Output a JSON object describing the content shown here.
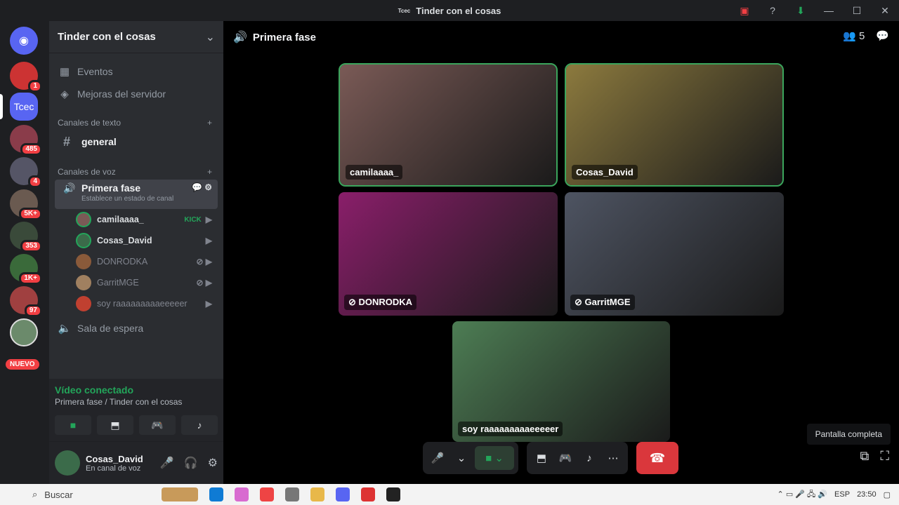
{
  "window": {
    "title": "Tinder con el cosas",
    "server_abbr": "Tcec"
  },
  "guilds": {
    "home_label": "Discord",
    "active_label": "Tcec",
    "badges": [
      "1",
      "485",
      "4",
      "5K+",
      "353",
      "1K+",
      "97"
    ],
    "new_label": "NUEVO"
  },
  "server": {
    "name": "Tinder con el cosas",
    "events": "Eventos",
    "boosts": "Mejoras del servidor",
    "text_category": "Canales de texto",
    "text_channel": "general",
    "voice_category": "Canales de voz",
    "voice_channel": "Primera fase",
    "voice_status_placeholder": "Establece un estado de canal",
    "voice_users": [
      {
        "name": "camilaaaa_",
        "tag": "KICK"
      },
      {
        "name": "Cosas_David"
      },
      {
        "name": "DONRODKA"
      },
      {
        "name": "GarritMGE"
      },
      {
        "name": "soy raaaaaaaaaeeeeer"
      }
    ],
    "waiting_room": "Sala de espera"
  },
  "voice_panel": {
    "status": "Vídeo conectado",
    "location": "Primera fase / Tinder con el cosas"
  },
  "user_panel": {
    "name": "Cosas_David",
    "status": "En canal de voz"
  },
  "main": {
    "channel": "Primera fase",
    "member_count": "5",
    "tiles": [
      {
        "label": "camilaaaa_",
        "color": "#7a5a56"
      },
      {
        "label": "Cosas_David",
        "color": "#8c7a3e"
      },
      {
        "label": "DONRODKA",
        "color": "#8a1e6a"
      },
      {
        "label": "GarritMGE",
        "color": "#4e5462"
      },
      {
        "label": "soy raaaaaaaaaeeeeer",
        "color": "#4d7d54"
      }
    ],
    "tooltip": "Pantalla completa"
  },
  "taskbar": {
    "search": "Buscar",
    "lang": "ESP",
    "time": "23:50"
  },
  "colors": {
    "accent_green": "#23a55a",
    "hangup_red": "#da373c",
    "badge_red": "#f23f43"
  }
}
